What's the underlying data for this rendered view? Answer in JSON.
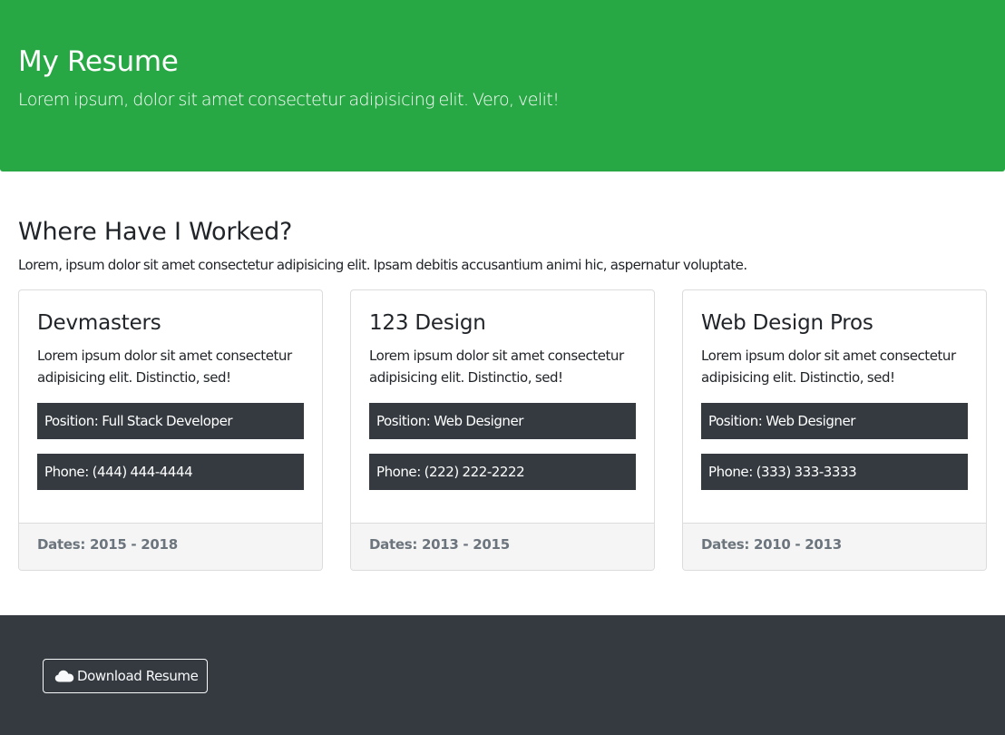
{
  "hero": {
    "title": "My Resume",
    "subtitle": "Lorem ipsum, dolor sit amet consectetur adipisicing elit. Vero, velit!"
  },
  "work": {
    "title": "Where Have I Worked?",
    "subtitle": "Lorem, ipsum dolor sit amet consectetur adipisicing elit. Ipsam debitis accusantium animi hic, aspernatur voluptate.",
    "cards": [
      {
        "company": "Devmasters",
        "text": "Lorem ipsum dolor sit amet consectetur adipisicing elit. Distinctio, sed!",
        "position": "Position: Full Stack Developer",
        "phone": "Phone: (444) 444-4444",
        "dates": "Dates: 2015 - 2018"
      },
      {
        "company": "123 Design",
        "text": "Lorem ipsum dolor sit amet consectetur adipisicing elit. Distinctio, sed!",
        "position": "Position: Web Designer",
        "phone": "Phone: (222) 222-2222",
        "dates": "Dates: 2013 - 2015"
      },
      {
        "company": "Web Design Pros",
        "text": "Lorem ipsum dolor sit amet consectetur adipisicing elit. Distinctio, sed!",
        "position": "Position: Web Designer",
        "phone": "Phone: (333) 333-3333",
        "dates": "Dates: 2010 - 2013"
      }
    ]
  },
  "footer": {
    "download_label": "Download Resume",
    "download_icon": "cloud-icon"
  },
  "colors": {
    "hero_bg": "#28a745",
    "footer_bg": "#343a40",
    "box_bg": "#343a40",
    "card_footer_bg": "#f5f5f5",
    "muted_text": "#6c757d"
  }
}
